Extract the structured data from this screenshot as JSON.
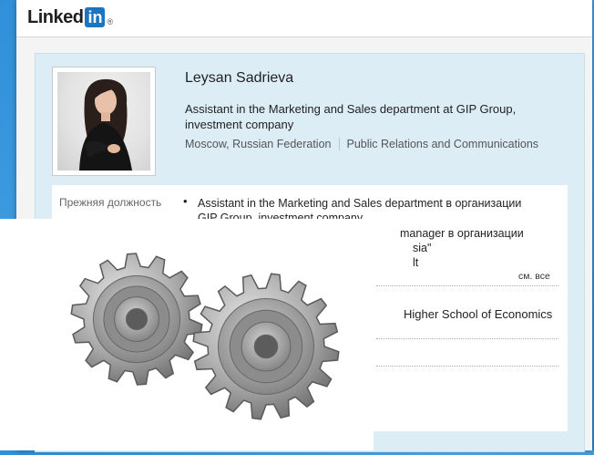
{
  "logo": {
    "word": "Linked",
    "in": "in",
    "reg": "®"
  },
  "profile": {
    "name": "Leysan Sadrieva",
    "headline": "Assistant in the Marketing and Sales department at GIP Group, investment company",
    "location": "Moscow, Russian Federation",
    "industry": "Public Relations and Communications"
  },
  "details": {
    "previous_label": "Прежняя должность",
    "bullet": "•",
    "previous_text": "Assistant in the Marketing and Sales department в организации GIP Group, investment company",
    "fragments": {
      "f1": "manager в организации",
      "f2": "sia\"",
      "f3": "lt",
      "f4": "Higher School of Economics"
    },
    "see_all": "см. все"
  },
  "colors": {
    "background": "#2f8fd8",
    "card": "#dcedf6",
    "linkedin_blue": "#1a76c0"
  },
  "overlay": {
    "icon": "gears-icon"
  }
}
